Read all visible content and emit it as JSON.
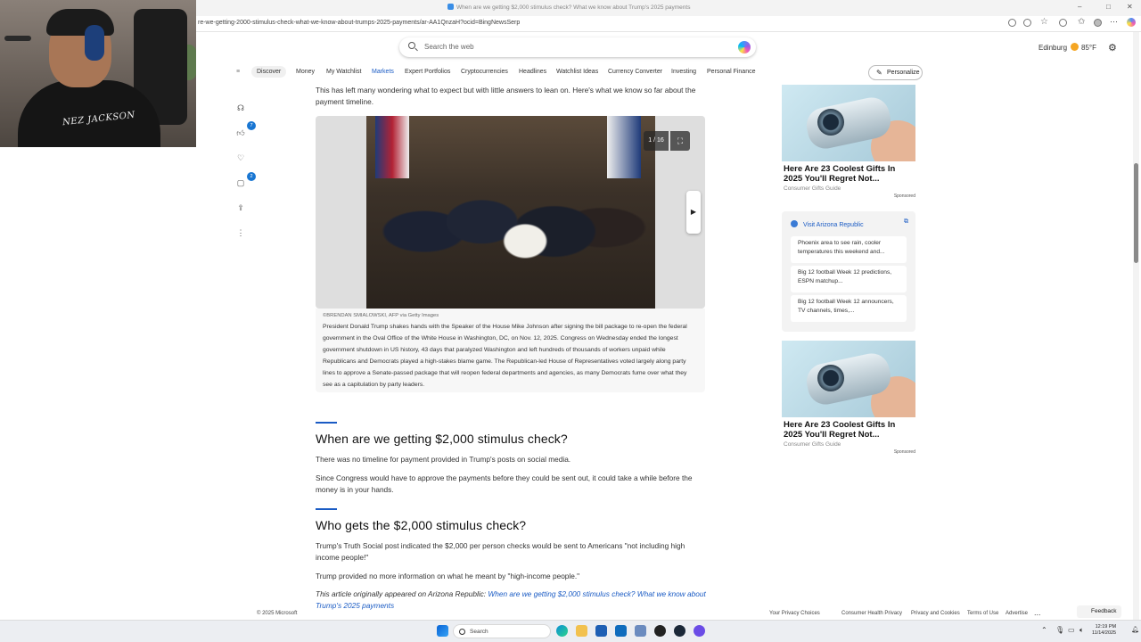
{
  "browser": {
    "tab_title": "When are we getting $2,000 stimulus check? What we know about Trump's 2025 payments",
    "url": "re-we-getting-2000-stimulus-check-what-we-know-about-trumps-2025-payments/ar-AA1QnzaH?ocid=BingNewsSerp",
    "window_controls": [
      "–",
      "□",
      "✕"
    ]
  },
  "header": {
    "search_placeholder": "Search the web",
    "location": "Edinburg",
    "temperature": "85°F",
    "personalize_label": "Personalize"
  },
  "nav": {
    "items": [
      "Discover",
      "Money",
      "My Watchlist",
      "Markets",
      "Expert Portfolios",
      "Cryptocurrencies",
      "Headlines",
      "Watchlist Ideas",
      "Currency Converter",
      "Investing",
      "Personal Finance"
    ],
    "active": "Markets"
  },
  "rail": {
    "like_count": "7",
    "comment_count": "2"
  },
  "article": {
    "intro": "This has left many wondering what to expect but with little answers to lean on. Here's what we know so far about the payment timeline.",
    "gallery_counter": "1 / 16",
    "photo_credit": "©BRENDAN SMIALOWSKI, AFP via Getty Images",
    "caption": "President Donald Trump shakes hands with the Speaker of the House Mike Johnson after signing the bill package to re-open the federal government in the Oval Office of the White House in Washington, DC, on Nov. 12, 2025. Congress on Wednesday ended the longest government shutdown in US history, 43 days that paralyzed Washington and left hundreds of thousands of workers unpaid while Republicans and Democrats played a high-stakes blame game. The Republican-led House of Representatives voted largely along party lines to approve a Senate-passed package that will reopen federal departments and agencies, as many Democrats fume over what they see as a capitulation by party leaders.",
    "h1": "When are we getting $2,000 stimulus check?",
    "p1": "There was no timeline for payment provided in Trump's posts on social media.",
    "p2": "Since Congress would have to approve the payments before they could be sent out, it could take a while before the money is in your hands.",
    "h2": "Who gets the $2,000 stimulus check?",
    "p3": "Trump's Truth Social post indicated the $2,000 per person checks would be sent to Americans \"not including high income people!\"",
    "p4": "Trump provided no more information on what he meant by \"high-income people.\"",
    "orig_prefix": "This article originally appeared on Arizona Republic: ",
    "orig_link": "When are we getting $2,000 stimulus check? What we know about Trump's 2025 payments"
  },
  "ads": [
    {
      "title": "Here Are 23 Coolest Gifts In 2025 You'll Regret Not...",
      "source": "Consumer Gifts Guide",
      "sponsored": "Sponsored"
    },
    {
      "title": "Here Are 23 Coolest Gifts In 2025 You'll Regret Not...",
      "source": "Consumer Gifts Guide",
      "sponsored": "Sponsored"
    }
  ],
  "azcard": {
    "header": "Visit Arizona Republic",
    "items": [
      "Phoenix area to see rain, cooler temperatures this weekend and...",
      "Big 12 football Week 12 predictions, ESPN matchup...",
      "Big 12 football Week 12 announcers, TV channels, times,..."
    ]
  },
  "footer": {
    "copyright": "© 2025 Microsoft",
    "links": [
      "Your Privacy Choices",
      "Consumer Health Privacy",
      "Privacy and Cookies",
      "Terms of Use",
      "Advertise"
    ],
    "more": "...",
    "feedback": "Feedback"
  },
  "taskbar": {
    "search": "Search",
    "time": "12:19 PM",
    "date": "11/14/2025"
  },
  "webcam": {
    "shirt_text": "NEZ JACKSON"
  }
}
